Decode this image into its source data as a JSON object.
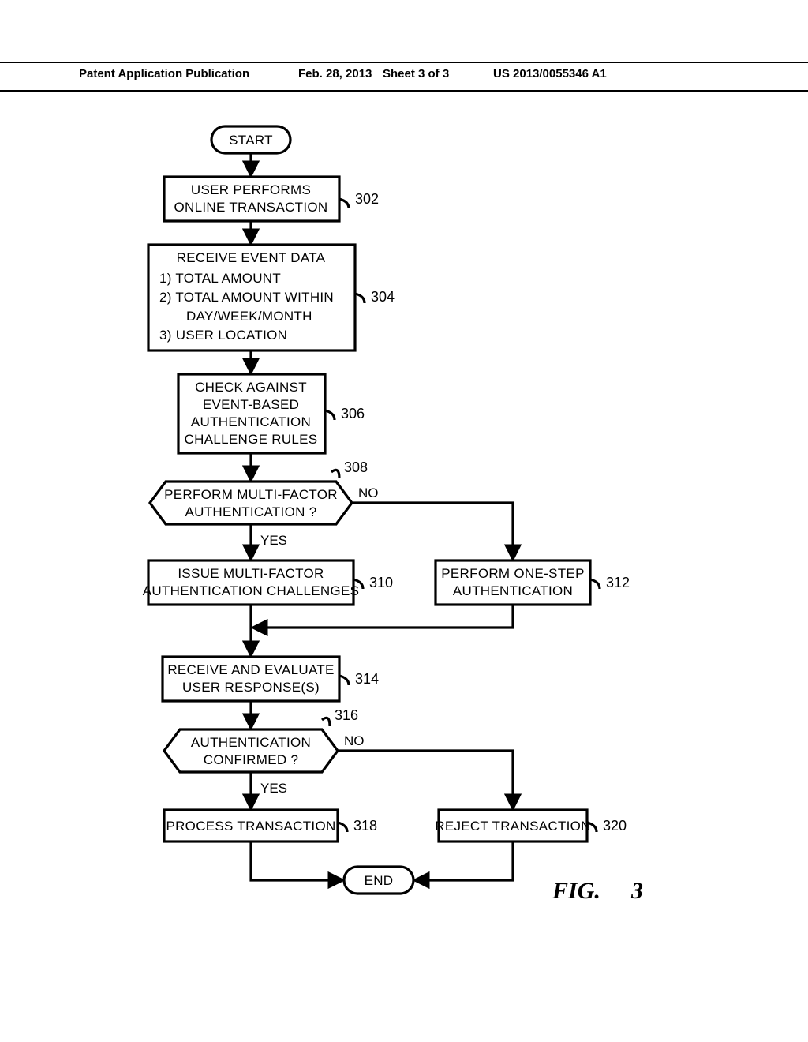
{
  "header": {
    "pub_type": "Patent Application Publication",
    "date": "Feb. 28, 2013",
    "sheet": "Sheet 3 of 3",
    "pubnum": "US 2013/0055346 A1"
  },
  "nodes": {
    "start": "START",
    "n302": {
      "l1": "USER PERFORMS",
      "l2": "ONLINE TRANSACTION"
    },
    "n304": {
      "title": "RECEIVE EVENT DATA",
      "i1": "1)  TOTAL AMOUNT",
      "i2": "2)  TOTAL AMOUNT WITHIN",
      "i2b": "DAY/WEEK/MONTH",
      "i3": "3)  USER LOCATION"
    },
    "n306": {
      "l1": "CHECK AGAINST",
      "l2": "EVENT-BASED",
      "l3": "AUTHENTICATION",
      "l4": "CHALLENGE RULES"
    },
    "n308": {
      "l1": "PERFORM MULTI-FACTOR",
      "l2": "AUTHENTICATION ?"
    },
    "n310": {
      "l1": "ISSUE MULTI-FACTOR",
      "l2": "AUTHENTICATION CHALLENGES"
    },
    "n312": {
      "l1": "PERFORM ONE-STEP",
      "l2": "AUTHENTICATION"
    },
    "n314": {
      "l1": "RECEIVE AND EVALUATE",
      "l2": "USER RESPONSE(S)"
    },
    "n316": {
      "l1": "AUTHENTICATION",
      "l2": "CONFIRMED ?"
    },
    "n318": "PROCESS TRANSACTION",
    "n320": "REJECT TRANSACTION",
    "end": "END"
  },
  "refs": {
    "r302": "302",
    "r304": "304",
    "r306": "306",
    "r308": "308",
    "r310": "310",
    "r312": "312",
    "r314": "314",
    "r316": "316",
    "r318": "318",
    "r320": "320"
  },
  "yn": {
    "yes": "YES",
    "no": "NO"
  },
  "figure": {
    "pre": "FIG.",
    "num": "3"
  }
}
